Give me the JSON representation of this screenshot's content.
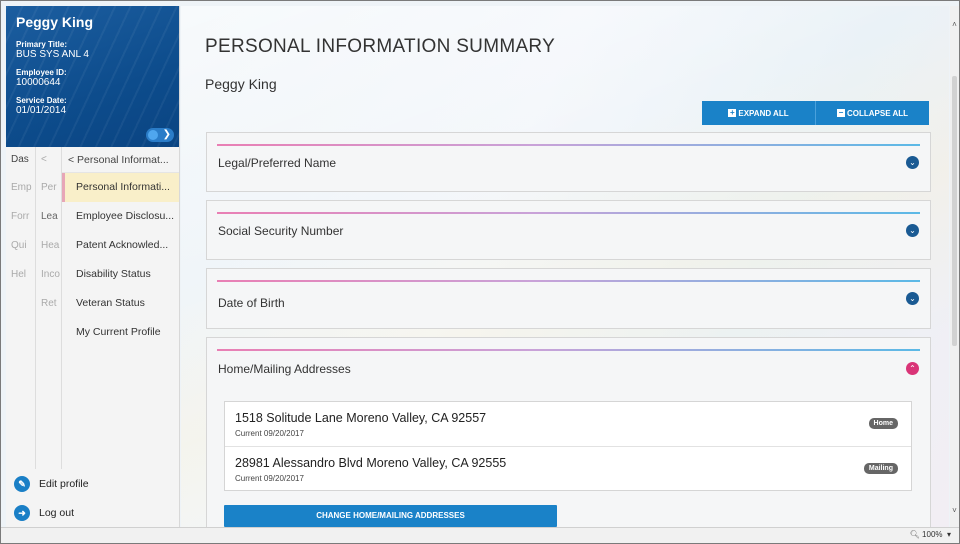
{
  "profile": {
    "name": "Peggy King",
    "primary_title_label": "Primary Title:",
    "primary_title": "BUS SYS ANL 4",
    "employee_id_label": "Employee ID:",
    "employee_id": "10000644",
    "service_date_label": "Service Date:",
    "service_date": "01/01/2014"
  },
  "nav": {
    "col1": [
      "Das",
      "Emp",
      "Forr",
      "Qui",
      "Hel"
    ],
    "col2": [
      "<",
      "Per",
      "Lea",
      "Hea",
      "Inco",
      "Ret"
    ],
    "col3_head": "< Personal Informat...",
    "col3_items": [
      "Personal Informati...",
      "Employee Disclosu...",
      "Patent Acknowled...",
      "Disability Status",
      "Veteran Status",
      "My Current Profile"
    ],
    "col1_back": "<"
  },
  "footer": {
    "edit_profile": "Edit profile",
    "log_out": "Log out"
  },
  "main": {
    "page_title": "PERSONAL INFORMATION SUMMARY",
    "person_name": "Peggy King",
    "expand_all": "EXPAND ALL",
    "collapse_all": "COLLAPSE ALL",
    "sections": [
      {
        "title": "Legal/Preferred Name",
        "expanded": false
      },
      {
        "title": "Social Security Number",
        "expanded": false
      },
      {
        "title": "Date of Birth",
        "expanded": false
      },
      {
        "title": "Home/Mailing Addresses",
        "expanded": true
      }
    ],
    "addresses": [
      {
        "address": "1518 Solitude Lane Moreno Valley, CA 92557",
        "status": "Current 09/20/2017",
        "type": "Home"
      },
      {
        "address": "28981 Alessandro Blvd Moreno Valley, CA 92555",
        "status": "Current 09/20/2017",
        "type": "Mailing"
      }
    ],
    "change_button": "CHANGE HOME/MAILING ADDRESSES"
  },
  "statusbar": {
    "zoom": "100%"
  },
  "colors": {
    "brand_blue": "#1a82c8",
    "profile_bg": "#0d4c8c",
    "chevron_closed": "#1a5a93",
    "chevron_open": "#d93477",
    "active_nav": "#f9efc9"
  }
}
